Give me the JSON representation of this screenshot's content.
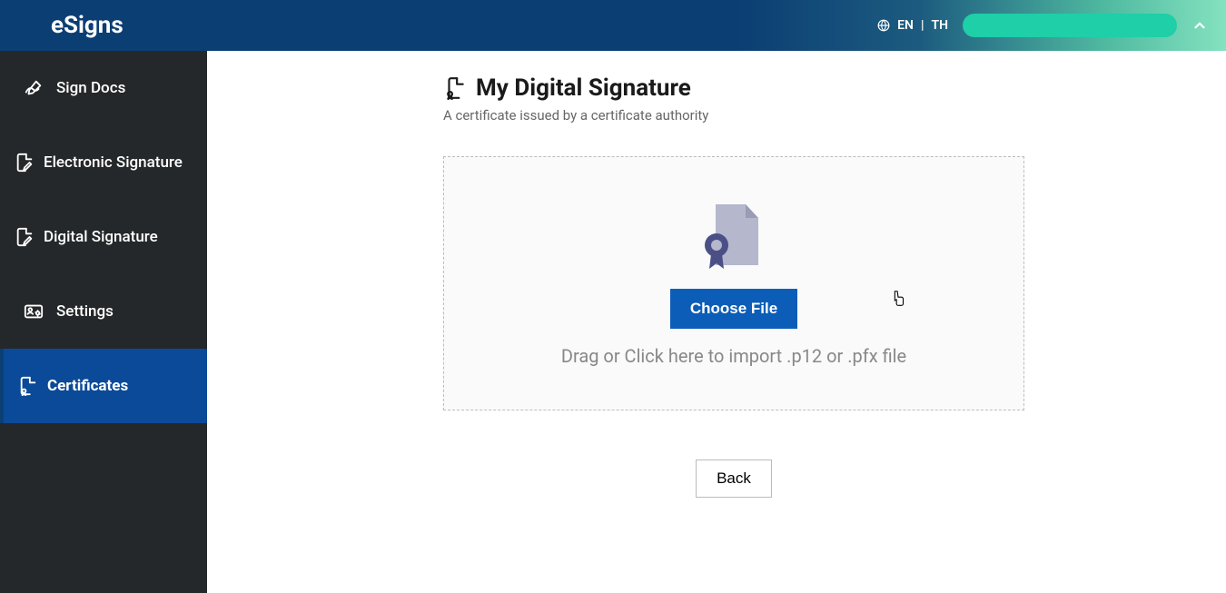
{
  "header": {
    "logo": "eSigns",
    "lang_primary": "EN",
    "lang_separator": "|",
    "lang_secondary": "TH"
  },
  "sidebar": {
    "items": [
      {
        "label": "Sign Docs"
      },
      {
        "label": "Electronic Signature"
      },
      {
        "label": "Digital Signature"
      },
      {
        "label": "Settings"
      },
      {
        "label": "Certificates"
      }
    ]
  },
  "page": {
    "title": "My Digital Signature",
    "subtitle": "A certificate issued by a certificate authority",
    "choose_file": "Choose File",
    "drop_hint": "Drag or Click here to import .p12 or .pfx file",
    "back": "Back"
  }
}
